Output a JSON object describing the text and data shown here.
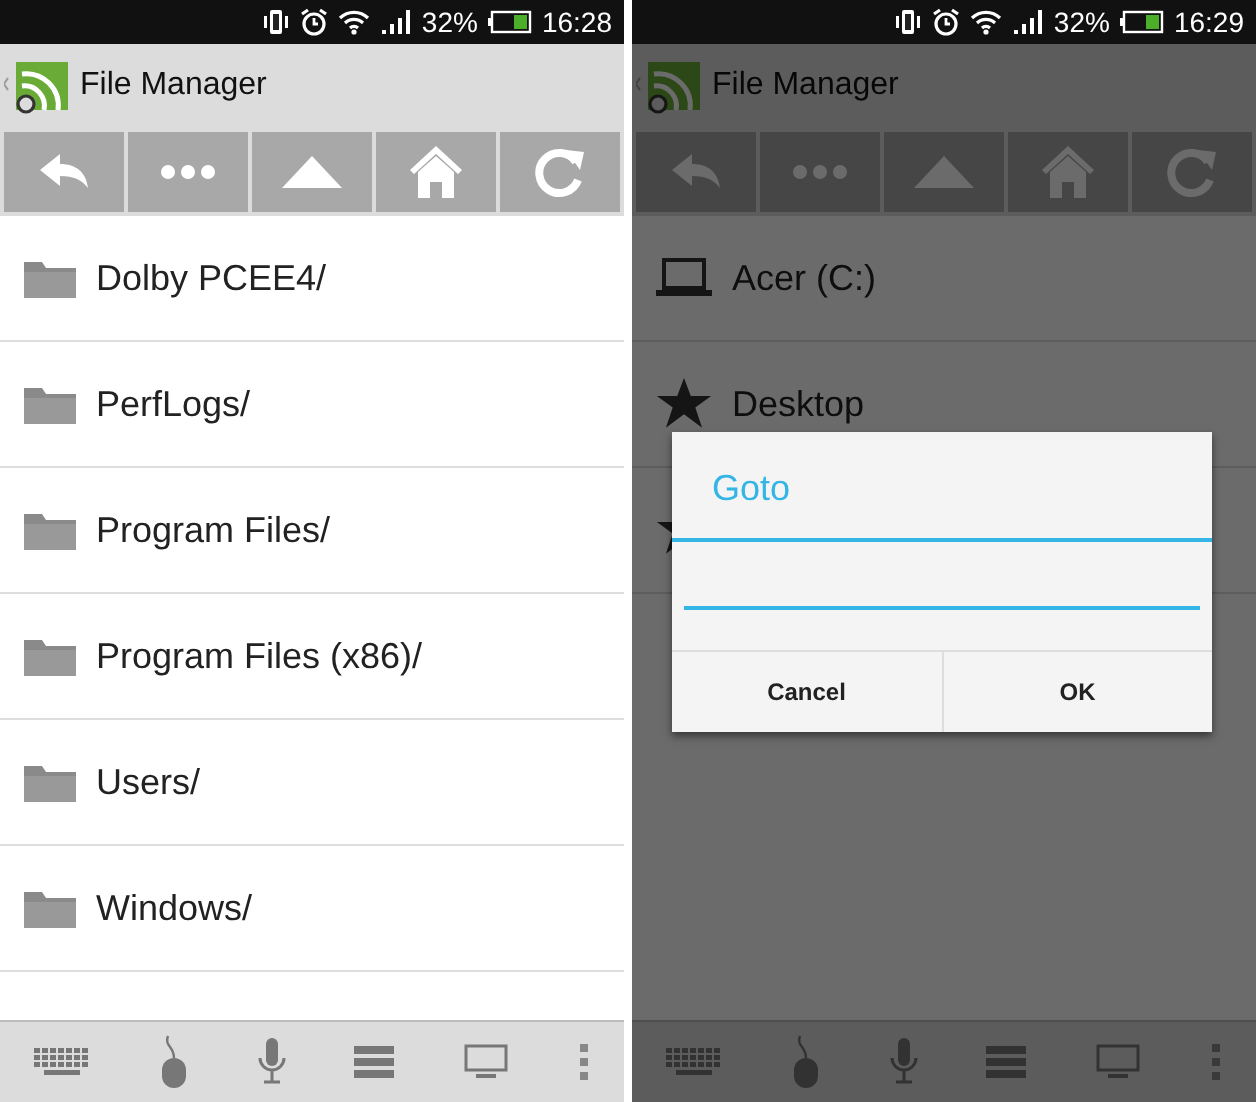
{
  "screens": [
    {
      "status_bar": {
        "battery": "32%",
        "time": "16:28"
      },
      "app_bar": {
        "title": "File Manager"
      },
      "items": [
        {
          "kind": "folder",
          "label": "Dolby PCEE4/"
        },
        {
          "kind": "folder",
          "label": "PerfLogs/"
        },
        {
          "kind": "folder",
          "label": "Program Files/"
        },
        {
          "kind": "folder",
          "label": "Program Files (x86)/"
        },
        {
          "kind": "folder",
          "label": "Users/"
        },
        {
          "kind": "folder",
          "label": "Windows/"
        }
      ]
    },
    {
      "status_bar": {
        "battery": "32%",
        "time": "16:29"
      },
      "app_bar": {
        "title": "File Manager"
      },
      "items": [
        {
          "kind": "drive",
          "label": "Acer (C:)"
        },
        {
          "kind": "favorite",
          "label": "Desktop"
        },
        {
          "kind": "favorite"
        }
      ],
      "dialog": {
        "title": "Goto",
        "buttons": [
          "Cancel",
          "OK"
        ]
      }
    }
  ]
}
